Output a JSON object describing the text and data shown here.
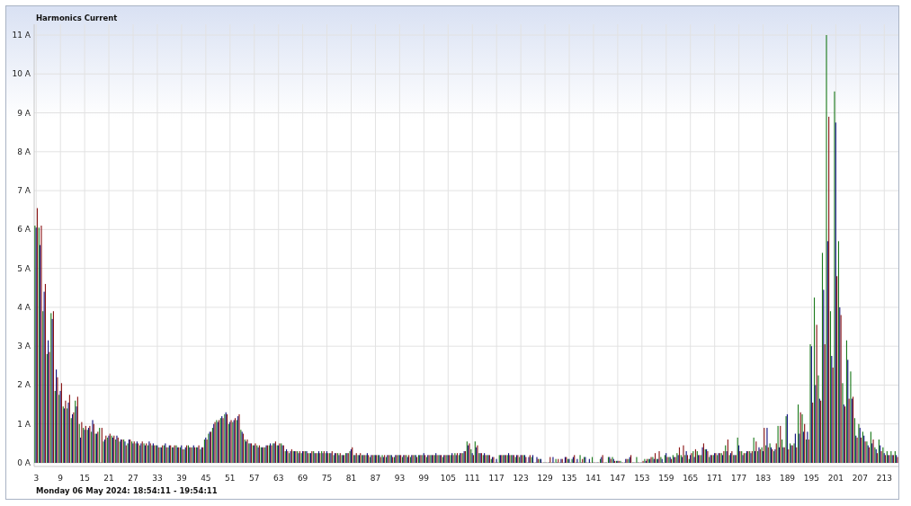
{
  "title": "Harmonics Current",
  "chart_data": {
    "type": "bar",
    "grid": true,
    "xlim": [
      3,
      216
    ],
    "x": [
      3,
      4,
      5,
      6,
      7,
      8,
      9,
      10,
      11,
      12,
      13,
      14,
      15,
      16,
      17,
      18,
      19,
      20,
      21,
      22,
      23,
      24,
      25,
      26,
      27,
      28,
      29,
      30,
      31,
      32,
      33,
      34,
      35,
      36,
      37,
      38,
      39,
      40,
      41,
      42,
      43,
      44,
      45,
      46,
      47,
      48,
      49,
      50,
      51,
      52,
      53,
      54,
      55,
      56,
      57,
      58,
      59,
      60,
      61,
      62,
      63,
      64,
      65,
      66,
      67,
      68,
      69,
      70,
      71,
      72,
      73,
      74,
      75,
      76,
      77,
      78,
      79,
      80,
      81,
      82,
      83,
      84,
      85,
      86,
      87,
      88,
      89,
      90,
      91,
      92,
      93,
      94,
      95,
      96,
      97,
      98,
      99,
      100,
      101,
      102,
      103,
      104,
      105,
      106,
      107,
      108,
      109,
      110,
      111,
      112,
      113,
      114,
      115,
      116,
      117,
      118,
      119,
      120,
      121,
      122,
      123,
      124,
      125,
      126,
      127,
      128,
      129,
      130,
      131,
      132,
      133,
      134,
      135,
      136,
      137,
      138,
      139,
      140,
      141,
      142,
      143,
      144,
      145,
      146,
      147,
      148,
      149,
      150,
      151,
      152,
      153,
      154,
      155,
      156,
      157,
      158,
      159,
      160,
      161,
      162,
      163,
      164,
      165,
      166,
      167,
      168,
      169,
      170,
      171,
      172,
      173,
      174,
      175,
      176,
      177,
      178,
      179,
      180,
      181,
      182,
      183,
      184,
      185,
      186,
      187,
      188,
      189,
      190,
      191,
      192,
      193,
      194,
      195,
      196,
      197,
      198,
      199,
      200,
      201,
      202,
      203,
      204,
      205,
      206,
      207,
      208,
      209,
      210,
      211,
      212,
      213,
      214,
      215,
      216
    ],
    "series": [
      {
        "color": "#1b7a1b",
        "values": [
          6.1,
          6.05,
          3.9,
          2.8,
          3.85,
          1.85,
          1.75,
          1.45,
          1.4,
          1.15,
          1.6,
          1.0,
          0.9,
          0.85,
          0.8,
          0.75,
          0.9,
          0.55,
          0.65,
          0.7,
          0.6,
          0.55,
          0.6,
          0.5,
          0.55,
          0.5,
          0.45,
          0.5,
          0.45,
          0.45,
          0.45,
          0.4,
          0.45,
          0.4,
          0.4,
          0.45,
          0.4,
          0.35,
          0.45,
          0.4,
          0.4,
          0.35,
          0.6,
          0.75,
          0.9,
          1.1,
          1.15,
          1.25,
          1.0,
          1.05,
          1.1,
          0.85,
          0.6,
          0.5,
          0.45,
          0.45,
          0.4,
          0.4,
          0.45,
          0.5,
          0.45,
          0.5,
          0.3,
          0.25,
          0.3,
          0.3,
          0.25,
          0.3,
          0.25,
          0.3,
          0.25,
          0.3,
          0.25,
          0.25,
          0.2,
          0.25,
          0.2,
          0.25,
          0.3,
          0.2,
          0.2,
          0.2,
          0.2,
          0.15,
          0.2,
          0.2,
          0.2,
          0.15,
          0.2,
          0.15,
          0.2,
          0.15,
          0.2,
          0.15,
          0.2,
          0.2,
          0.2,
          0.15,
          0.2,
          0.2,
          0.2,
          0.15,
          0.2,
          0.2,
          0.25,
          0.2,
          0.25,
          0.55,
          0.35,
          0.55,
          0.25,
          0.2,
          0.2,
          0.1,
          0,
          0.2,
          0.2,
          0.2,
          0.2,
          0.15,
          0.15,
          0.2,
          0,
          0.15,
          0,
          0.1,
          0,
          0,
          0,
          0.1,
          0,
          0,
          0.1,
          0.1,
          0,
          0.2,
          0.15,
          0,
          0.15,
          0,
          0.1,
          0,
          0.15,
          0.15,
          0.05,
          0.05,
          0,
          0.1,
          0,
          0.15,
          0,
          0.1,
          0.1,
          0.15,
          0.1,
          0.15,
          0.2,
          0.15,
          0.2,
          0.25,
          0.2,
          0.2,
          0.1,
          0.3,
          0.3,
          0.2,
          0.35,
          0.15,
          0.2,
          0.2,
          0.25,
          0.45,
          0.2,
          0.2,
          0.65,
          0.3,
          0.25,
          0.3,
          0.65,
          0.3,
          0.4,
          0.45,
          0.5,
          0.3,
          0.95,
          0.6,
          1.2,
          0.5,
          0.5,
          1.5,
          1.25,
          0.6,
          3.05,
          4.25,
          2.25,
          5.4,
          11.0,
          3.9,
          9.55,
          5.7,
          2.05,
          3.15,
          2.35,
          1.15,
          1.0,
          0.8,
          0.55,
          0.8,
          0.4,
          0.6,
          0.4,
          0.3,
          0.3,
          0.3
        ]
      },
      {
        "color": "#10107e",
        "values": [
          6.05,
          5.6,
          4.4,
          3.15,
          3.7,
          2.4,
          1.85,
          1.4,
          1.55,
          1.25,
          1.45,
          0.65,
          0.85,
          0.9,
          1.1,
          0.75,
          0,
          0.6,
          0.7,
          0.65,
          0.7,
          0.6,
          0.55,
          0.6,
          0.5,
          0.55,
          0.5,
          0.45,
          0.55,
          0.5,
          0.45,
          0.4,
          0.5,
          0.45,
          0.4,
          0.4,
          0.45,
          0.4,
          0.4,
          0.45,
          0.4,
          0.4,
          0.65,
          0.8,
          1.0,
          1.05,
          1.2,
          1.3,
          1.05,
          1.1,
          1.2,
          0.8,
          0.55,
          0.5,
          0.45,
          0.4,
          0.4,
          0.45,
          0.5,
          0.5,
          0.45,
          0.45,
          0.35,
          0.3,
          0.3,
          0.25,
          0.3,
          0.3,
          0.25,
          0.25,
          0.3,
          0.25,
          0.3,
          0.25,
          0.25,
          0.2,
          0.2,
          0.25,
          0.35,
          0.2,
          0.2,
          0.2,
          0.25,
          0.2,
          0.2,
          0.2,
          0.15,
          0.2,
          0.2,
          0.2,
          0.2,
          0.2,
          0.15,
          0.2,
          0.2,
          0.2,
          0.25,
          0.2,
          0.2,
          0.25,
          0.2,
          0.2,
          0.2,
          0.25,
          0.2,
          0.25,
          0.3,
          0.45,
          0.25,
          0.4,
          0.25,
          0.25,
          0.2,
          0.15,
          0.1,
          0.2,
          0.2,
          0.25,
          0.2,
          0.2,
          0.2,
          0.2,
          0.15,
          0.2,
          0.15,
          0.1,
          0,
          0,
          0.15,
          0,
          0.1,
          0.15,
          0.1,
          0.15,
          0.1,
          0,
          0.15,
          0.1,
          0,
          0,
          0.15,
          0,
          0.15,
          0.1,
          0.05,
          0,
          0.1,
          0.15,
          0,
          0,
          0,
          0.05,
          0.1,
          0.1,
          0.1,
          0.1,
          0.25,
          0.15,
          0.15,
          0.2,
          0.15,
          0.3,
          0.2,
          0.15,
          0.2,
          0.4,
          0.35,
          0.2,
          0.25,
          0.25,
          0.2,
          0.3,
          0.25,
          0.2,
          0.45,
          0.2,
          0.3,
          0.25,
          0.3,
          0.4,
          0.3,
          0.9,
          0.4,
          0.35,
          0.4,
          0.4,
          1.25,
          0.45,
          0.75,
          0.75,
          0.8,
          0.8,
          3.0,
          2.0,
          1.65,
          4.45,
          5.7,
          2.75,
          8.75,
          4.0,
          1.5,
          2.65,
          1.65,
          0.7,
          0.9,
          0.7,
          0.45,
          0.5,
          0.35,
          0.45,
          0.25,
          0.2,
          0.2,
          0.2
        ]
      },
      {
        "color": "#8a1414",
        "values": [
          6.55,
          6.1,
          4.6,
          2.85,
          3.9,
          2.2,
          2.05,
          1.6,
          1.75,
          1.3,
          1.7,
          1.05,
          0.95,
          0.95,
          1.0,
          0.8,
          0.9,
          0.7,
          0.75,
          0.7,
          0.65,
          0.6,
          0.45,
          0.6,
          0.55,
          0.5,
          0.55,
          0.5,
          0.5,
          0.45,
          0.4,
          0.45,
          0.4,
          0.45,
          0.45,
          0.4,
          0.35,
          0.45,
          0.4,
          0.4,
          0.45,
          0.4,
          0.6,
          0.8,
          1.05,
          1.1,
          1.15,
          1.25,
          1.1,
          1.15,
          1.25,
          0.75,
          0.6,
          0.5,
          0.5,
          0.45,
          0.4,
          0.45,
          0.45,
          0.55,
          0.5,
          0.45,
          0.3,
          0.35,
          0.3,
          0.3,
          0.3,
          0.25,
          0.3,
          0.25,
          0.25,
          0.3,
          0.25,
          0.3,
          0.25,
          0.25,
          0.2,
          0.25,
          0.4,
          0.25,
          0.25,
          0.2,
          0.2,
          0.2,
          0.2,
          0.15,
          0.2,
          0.2,
          0.15,
          0.2,
          0.2,
          0.2,
          0.2,
          0.2,
          0.15,
          0.2,
          0.2,
          0.2,
          0.2,
          0.2,
          0.2,
          0.2,
          0.2,
          0.2,
          0.25,
          0.25,
          0.3,
          0.5,
          0.2,
          0.45,
          0.25,
          0.2,
          0.2,
          0.15,
          0,
          0.2,
          0.2,
          0.2,
          0.2,
          0.2,
          0.2,
          0.15,
          0.2,
          0,
          0.1,
          0,
          0,
          0.15,
          0,
          0.1,
          0.1,
          0.15,
          0,
          0.2,
          0,
          0.1,
          0,
          0,
          0,
          0,
          0.2,
          0,
          0.1,
          0.05,
          0.05,
          0,
          0.1,
          0.2,
          0,
          0,
          0.05,
          0.1,
          0.15,
          0.25,
          0.3,
          0,
          0.15,
          0.1,
          0.15,
          0.4,
          0.45,
          0.2,
          0.25,
          0.35,
          0.2,
          0.5,
          0.3,
          0.2,
          0.25,
          0.25,
          0.3,
          0.6,
          0.3,
          0.2,
          0.3,
          0.25,
          0.3,
          0.3,
          0.55,
          0.35,
          0.9,
          0.4,
          0.35,
          0.5,
          0.95,
          0.4,
          0.35,
          0.45,
          0.4,
          1.3,
          1.0,
          0.6,
          1.55,
          3.55,
          1.6,
          3.05,
          8.9,
          2.45,
          4.8,
          3.8,
          1.45,
          1.65,
          1.7,
          0.65,
          0.65,
          0.55,
          0.4,
          0.6,
          0.25,
          0.3,
          0.2,
          0.2,
          0.2,
          0.15
        ]
      }
    ],
    "ylim": [
      0,
      11
    ],
    "yticks": [
      {
        "value": 0,
        "label": "0 A"
      },
      {
        "value": 1,
        "label": "1 A"
      },
      {
        "value": 2,
        "label": "2 A"
      },
      {
        "value": 3,
        "label": "3 A"
      },
      {
        "value": 4,
        "label": "4 A"
      },
      {
        "value": 5,
        "label": "5 A"
      },
      {
        "value": 6,
        "label": "6 A"
      },
      {
        "value": 7,
        "label": "7 A"
      },
      {
        "value": 8,
        "label": "8 A"
      },
      {
        "value": 9,
        "label": "9 A"
      },
      {
        "value": 10,
        "label": "10 A"
      },
      {
        "value": 11,
        "label": "11 A"
      }
    ],
    "xticks": [
      3,
      9,
      15,
      21,
      27,
      33,
      39,
      45,
      51,
      57,
      63,
      69,
      75,
      81,
      87,
      93,
      99,
      105,
      111,
      117,
      123,
      129,
      135,
      141,
      147,
      153,
      159,
      165,
      171,
      177,
      183,
      189,
      195,
      201,
      207,
      213
    ]
  },
  "footer": "Monday 06 May 2024: 18:54:11 - 19:54:11"
}
